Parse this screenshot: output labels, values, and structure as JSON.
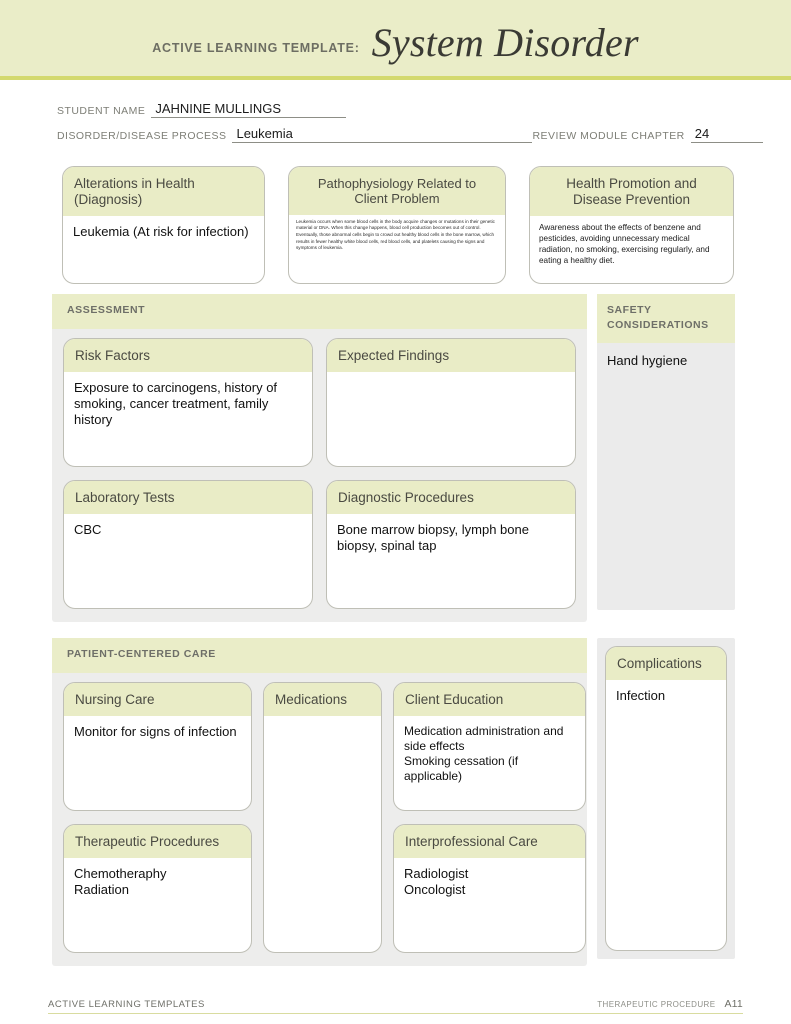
{
  "header": {
    "eyebrow": "ACTIVE LEARNING TEMPLATE:",
    "title": "System Disorder",
    "band_color": "#eaedc8",
    "rule_color": "#d3d96e"
  },
  "ident": {
    "student_name_label": "STUDENT NAME",
    "student_name_value": "JAHNINE MULLINGS",
    "disorder_label": "DISORDER/DISEASE PROCESS",
    "disorder_value": "Leukemia",
    "chapter_label": "REVIEW MODULE CHAPTER",
    "chapter_value": "24"
  },
  "top_boxes": [
    {
      "title": "Alterations in\nHealth (Diagnosis)",
      "body": "Leukemia (At risk for infection)"
    },
    {
      "title": "Pathophysiology Related\nto Client Problem",
      "body": "Leukemia occurs when some blood cells in the body acquire changes or mutations in their genetic material or DNA. When this change happens, blood cell production becomes out of control. Eventually, those abnormal cells begin to crowd out healthy blood cells in the bone marrow, which results in fewer healthy white blood cells, red blood cells, and platelets causing the signs and symptoms of leukemia."
    },
    {
      "title": "Health Promotion and\nDisease Prevention",
      "body": "Awareness about the effects of benzene and pesticides, avoiding unnecessary medical radiation, no smoking, exercising regularly, and eating a healthy diet."
    }
  ],
  "assessment": {
    "section_label": "ASSESSMENT",
    "cards": [
      {
        "title": "Risk Factors",
        "body": "Exposure to carcinogens, history of smoking, cancer treatment, family history"
      },
      {
        "title": "Expected Findings",
        "body": ""
      },
      {
        "title": "Laboratory Tests",
        "body": "CBC"
      },
      {
        "title": "Diagnostic Procedures",
        "body": "Bone marrow biopsy, lymph bone biopsy, spinal tap"
      }
    ]
  },
  "safety": {
    "section_label": "SAFETY\nCONSIDERATIONS",
    "body": "Hand hygiene"
  },
  "patient_centered_care": {
    "section_label": "PATIENT-CENTERED CARE",
    "cards": [
      {
        "title": "Nursing Care",
        "body": "Monitor for signs of infection"
      },
      {
        "title": "Therapeutic Procedures",
        "body": "Chemotheraphy\nRadiation"
      },
      {
        "title": "Medications",
        "body": ""
      },
      {
        "title": "Client Education",
        "body": "Medication administration and side effects\nSmoking cessation (if applicable)"
      },
      {
        "title": "Interprofessional Care",
        "body": "Radiologist\nOncologist"
      }
    ]
  },
  "complications": {
    "title": "Complications",
    "body": "Infection"
  },
  "footer": {
    "left": "ACTIVE LEARNING TEMPLATES",
    "right": "THERAPEUTIC PROCEDURE",
    "page": "A11"
  }
}
